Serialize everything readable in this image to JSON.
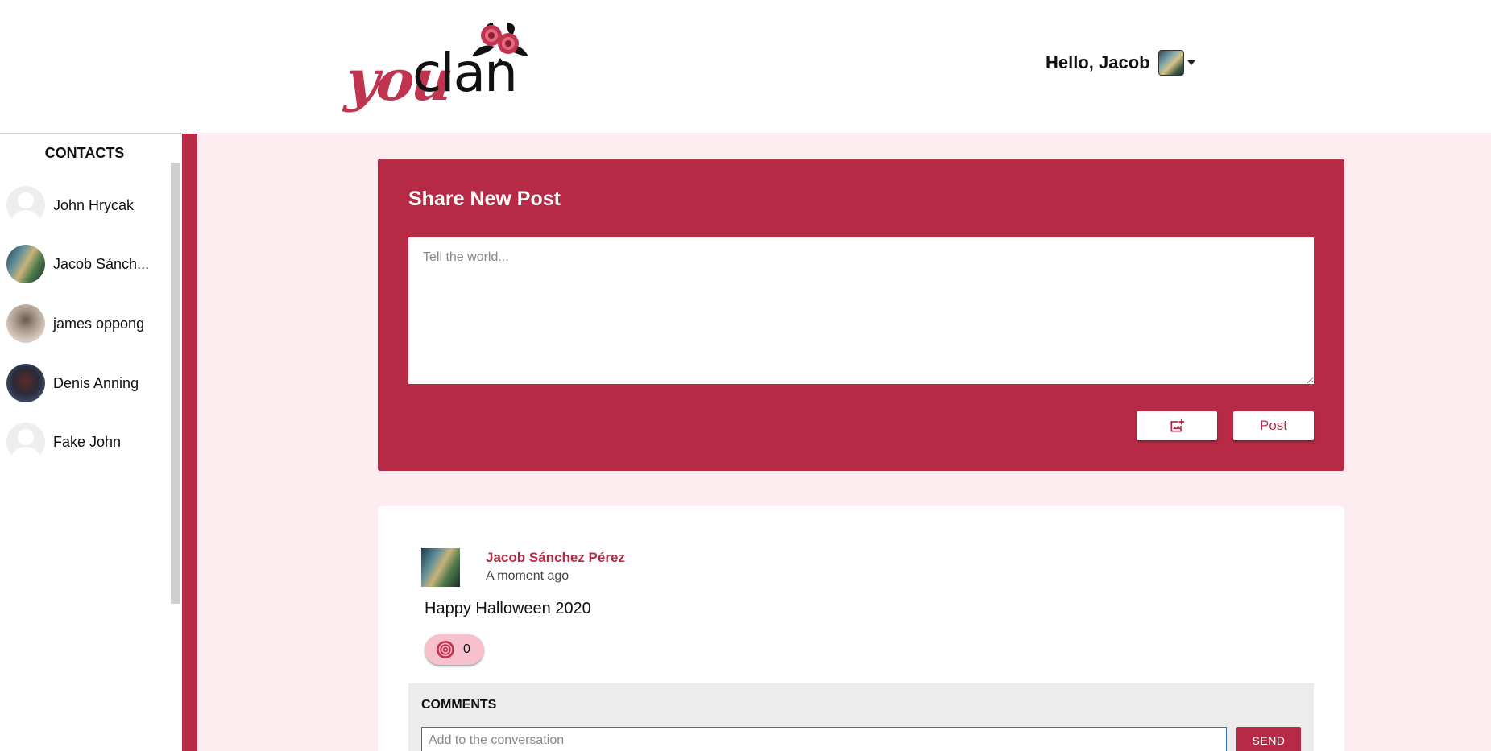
{
  "header": {
    "logo": {
      "you": "you",
      "clan": "clan",
      "icon": "rose-flowers-icon"
    },
    "greeting": "Hello, Jacob",
    "avatar_icon": "user-avatar",
    "caret_icon": "caret-down-icon"
  },
  "sidebar": {
    "title": "CONTACTS",
    "contacts": [
      {
        "name": "John Hrycak",
        "avatar": "default-avatar"
      },
      {
        "name": "Jacob Sánch...",
        "avatar": "photo-avatar"
      },
      {
        "name": "james oppong",
        "avatar": "photo-avatar"
      },
      {
        "name": "Denis Anning",
        "avatar": "photo-avatar"
      },
      {
        "name": "Fake John",
        "avatar": "default-avatar"
      }
    ]
  },
  "share_post": {
    "title": "Share New Post",
    "placeholder": "Tell the world...",
    "add_image_icon": "add-photo-icon",
    "post_label": "Post"
  },
  "post": {
    "author": "Jacob Sánchez Pérez",
    "time": "A moment ago",
    "content": "Happy Halloween 2020",
    "like_icon": "rose-icon",
    "like_count": "0",
    "comments": {
      "title": "COMMENTS",
      "placeholder": "Add to the conversation",
      "send_label": "SEND"
    }
  },
  "colors": {
    "brand": "#b72a45",
    "background": "#fdecef",
    "like_pill": "#f6c1cc"
  }
}
